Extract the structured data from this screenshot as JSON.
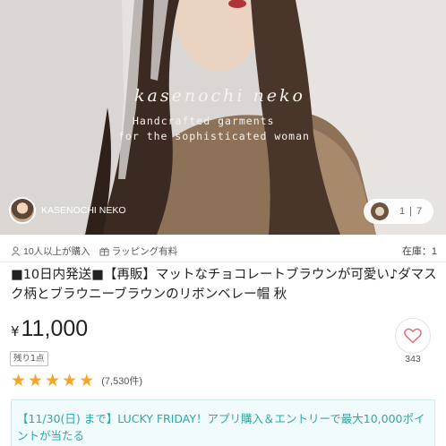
{
  "gallery": {
    "overlay": {
      "brand_script": "kasenochi neko",
      "tagline_line1": "Handcrafted garments",
      "tagline_line2": "for the sophisticated woman"
    },
    "shop_name": "KASENOCHI NEKO",
    "page_indicator": "1 | 7"
  },
  "product": {
    "purchase_count": "10人以上が購入",
    "wrapping": "ラッピング有料",
    "stock": "在庫：1",
    "title": "■10日内発送■【再販】マットなチョコレートブラウンが可愛い♪ダマスク柄とブラウニーブラウンのリボンベレー帽 秋",
    "currency_symbol": "¥",
    "price": "11,000",
    "remaining_badge": "残り1点",
    "rating_stars": 5,
    "review_count": "(7,530件)",
    "like_count": "343"
  },
  "promo": {
    "text": "【11/30(日) まで】LUCKY FRIDAY！アプリ購入＆エントリーで最大10,000ポイントが当たる"
  },
  "colors": {
    "star": "#f4a62a",
    "promo_text": "#29a9a9",
    "promo_bg": "#f2fbfb"
  },
  "icons": [
    "person-icon",
    "gift-icon",
    "heart-icon",
    "star-icon"
  ]
}
